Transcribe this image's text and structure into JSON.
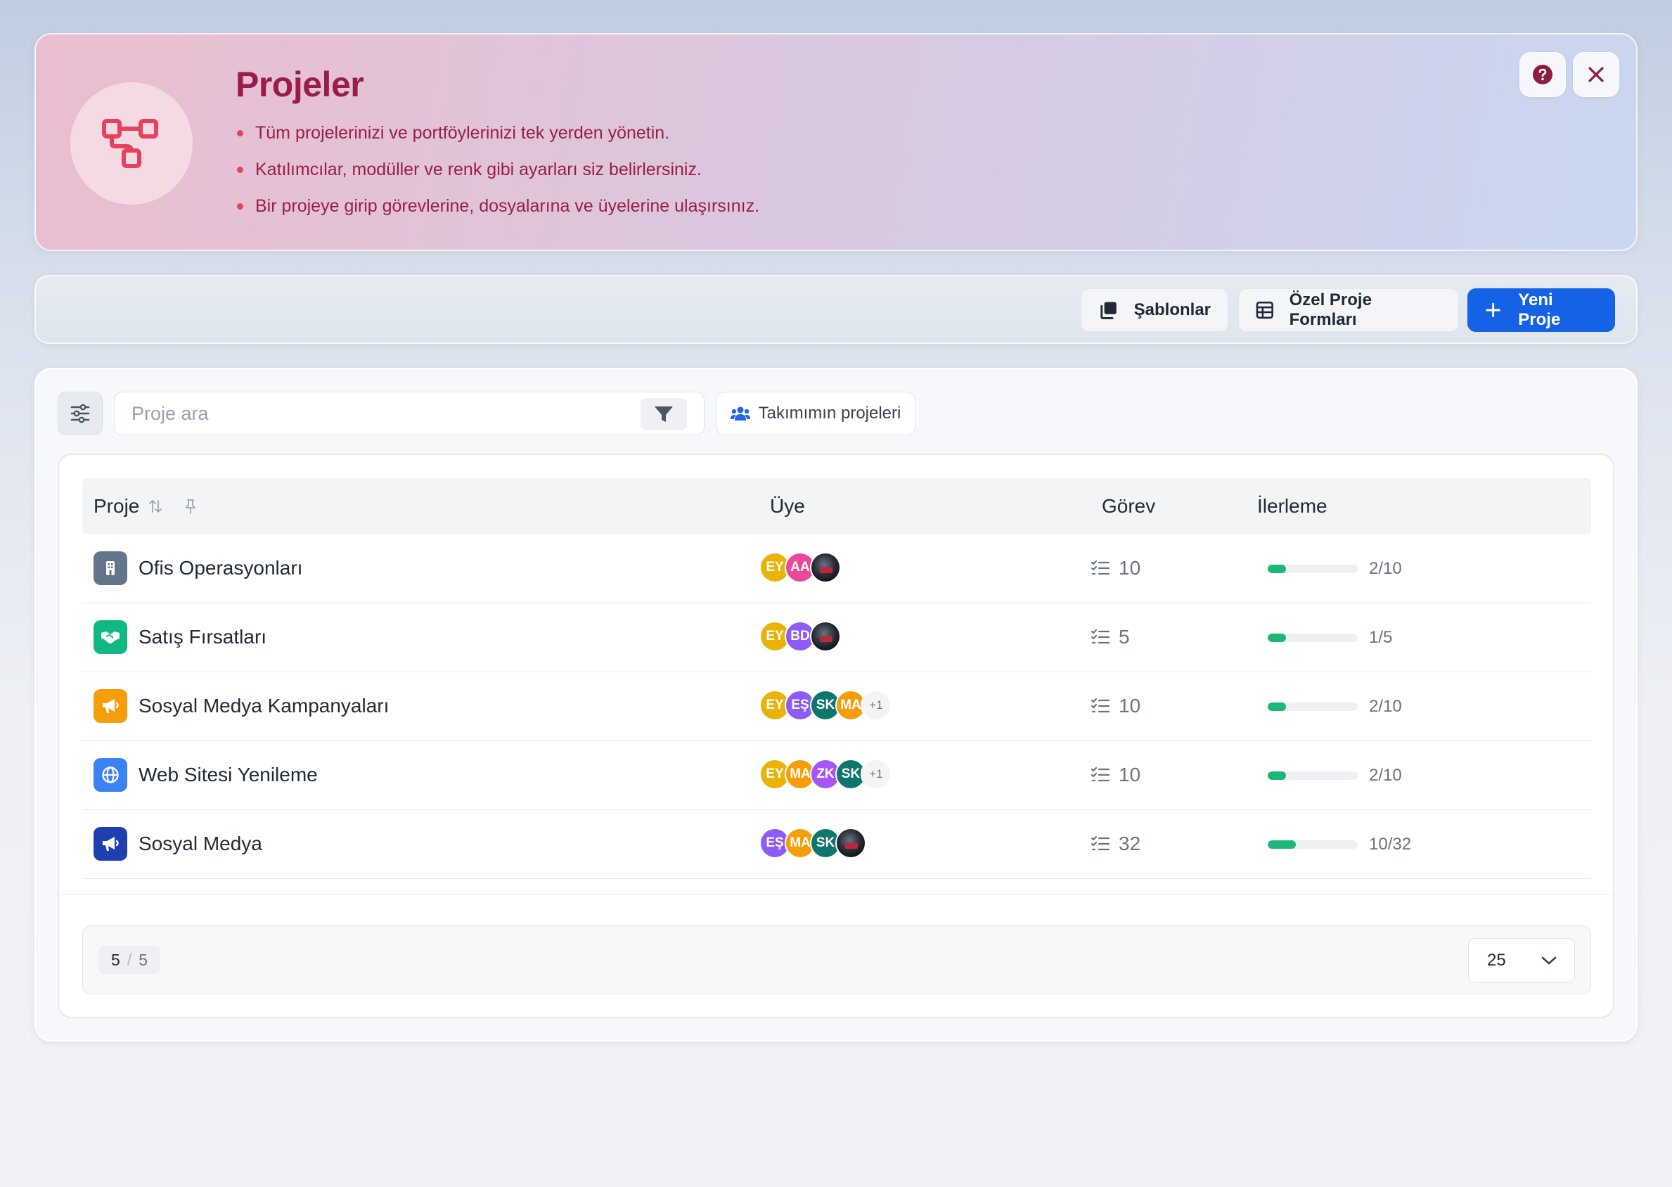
{
  "header": {
    "title": "Projeler",
    "bullets": [
      "Tüm projelerinizi ve portföylerinizi tek yerden yönetin.",
      "Katılımcılar, modüller ve renk gibi ayarları siz belirlersiniz.",
      "Bir projeye girip görevlerine, dosyalarına ve üyelerine ulaşırsınız."
    ],
    "icon": "project-diagram-icon",
    "accent_color": "#9a1d48"
  },
  "toolbar": {
    "templates_label": "Şablonlar",
    "custom_forms_label": "Özel Proje Formları",
    "new_project_label": "Yeni Proje",
    "primary_color": "#1562e6"
  },
  "search": {
    "placeholder": "Proje ara",
    "value": "",
    "team_projects_label": "Takımımın projeleri"
  },
  "table": {
    "columns": {
      "project": "Proje",
      "member": "Üye",
      "task": "Görev",
      "progress": "İlerleme"
    },
    "rows": [
      {
        "name": "Ofis Operasyonları",
        "icon": "building-icon",
        "icon_color": "#64748b",
        "members": [
          {
            "initials": "EY",
            "color": "#eab308"
          },
          {
            "initials": "AA",
            "color": "#ec4899"
          },
          {
            "initials": "",
            "photo": true
          }
        ],
        "more": "",
        "tasks": "10",
        "progress_text": "2/10",
        "progress": 0.2
      },
      {
        "name": "Satış Fırsatları",
        "icon": "handshake-icon",
        "icon_color": "#10b981",
        "members": [
          {
            "initials": "EY",
            "color": "#eab308"
          },
          {
            "initials": "BD",
            "color": "#8b5cf6"
          },
          {
            "initials": "",
            "photo": true
          }
        ],
        "more": "",
        "tasks": "5",
        "progress_text": "1/5",
        "progress": 0.2
      },
      {
        "name": "Sosyal Medya Kampanyaları",
        "icon": "megaphone-icon",
        "icon_color": "#f59e0b",
        "members": [
          {
            "initials": "EY",
            "color": "#eab308"
          },
          {
            "initials": "EŞ",
            "color": "#8b5cf6"
          },
          {
            "initials": "SK",
            "color": "#0f766e"
          },
          {
            "initials": "MA",
            "color": "#f59e0b"
          }
        ],
        "more": "+1",
        "tasks": "10",
        "progress_text": "2/10",
        "progress": 0.2
      },
      {
        "name": "Web Sitesi Yenileme",
        "icon": "globe-icon",
        "icon_color": "#3b82f6",
        "members": [
          {
            "initials": "EY",
            "color": "#eab308"
          },
          {
            "initials": "MA",
            "color": "#f59e0b"
          },
          {
            "initials": "ZK",
            "color": "#a855f7"
          },
          {
            "initials": "SK",
            "color": "#0f766e"
          }
        ],
        "more": "+1",
        "tasks": "10",
        "progress_text": "2/10",
        "progress": 0.2
      },
      {
        "name": "Sosyal Medya",
        "icon": "megaphone-icon",
        "icon_color": "#1e40af",
        "members": [
          {
            "initials": "EŞ",
            "color": "#8b5cf6"
          },
          {
            "initials": "MA",
            "color": "#f59e0b"
          },
          {
            "initials": "SK",
            "color": "#0f766e"
          },
          {
            "initials": "",
            "photo": true
          }
        ],
        "more": "",
        "tasks": "32",
        "progress_text": "10/32",
        "progress": 0.3125
      }
    ]
  },
  "pagination": {
    "shown": "5",
    "separator": "/",
    "total": "5",
    "page_size": "25"
  },
  "colors": {
    "progress": "#1bb87a",
    "bullet": "#e0465f"
  }
}
